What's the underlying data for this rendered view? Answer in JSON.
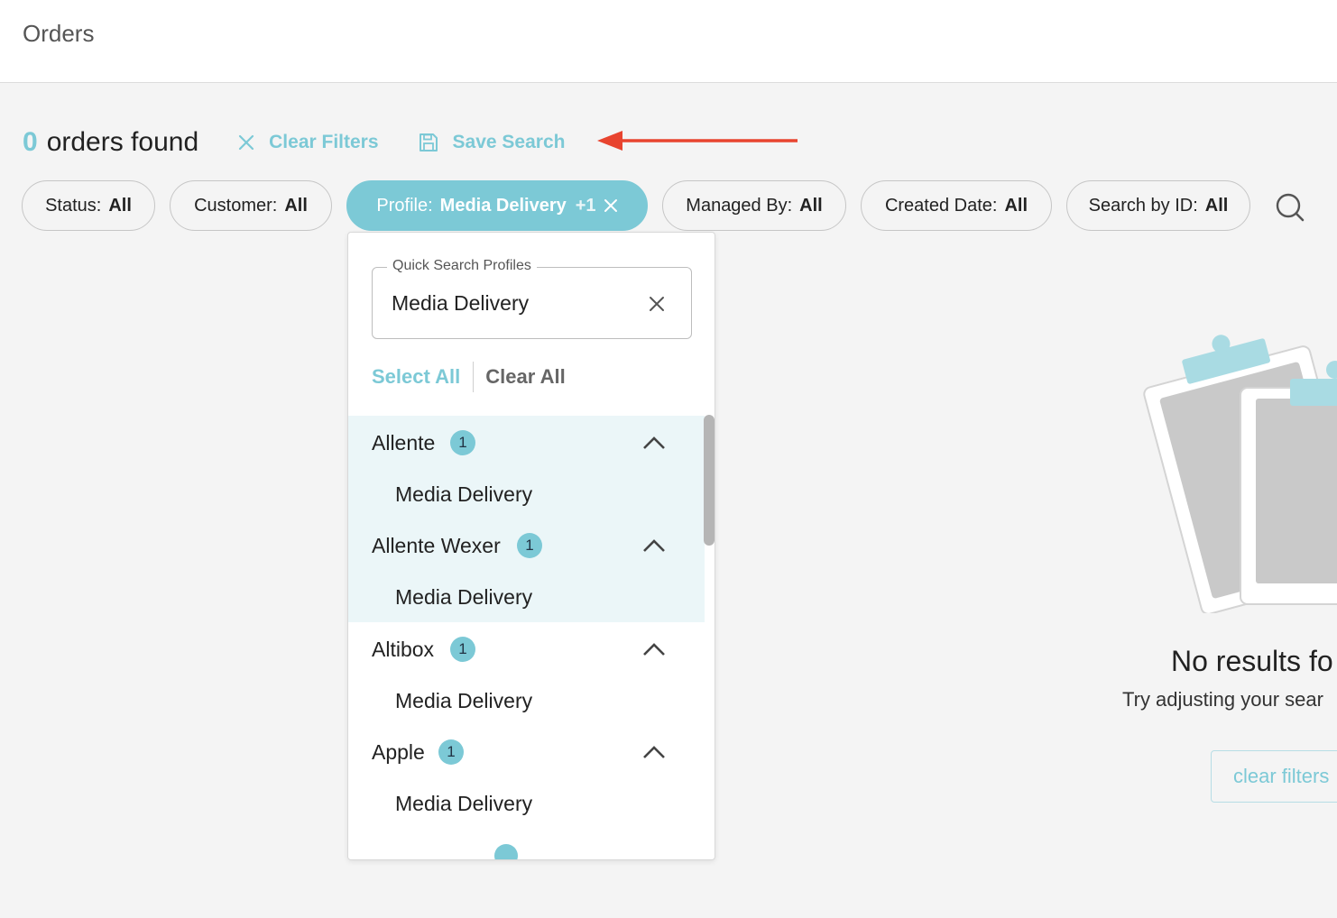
{
  "header": {
    "title": "Orders"
  },
  "results": {
    "count": "0",
    "label": "orders found",
    "clear_filters": "Clear Filters",
    "save_search": "Save Search"
  },
  "filters": [
    {
      "key": "Status:",
      "value": "All"
    },
    {
      "key": "Customer:",
      "value": "All"
    },
    {
      "key": "Profile:",
      "value": "Media Delivery",
      "extra": "+1",
      "active": true
    },
    {
      "key": "Managed By:",
      "value": "All"
    },
    {
      "key": "Created Date:",
      "value": "All"
    },
    {
      "key": "Search by ID:",
      "value": "All"
    }
  ],
  "dropdown": {
    "search_legend": "Quick Search Profiles",
    "search_value": "Media Delivery",
    "select_all": "Select All",
    "clear_all": "Clear All",
    "groups": [
      {
        "name": "Allente",
        "count": "1",
        "item": "Media Delivery",
        "selected": true
      },
      {
        "name": "Allente Wexer",
        "count": "1",
        "item": "Media Delivery",
        "selected": true
      },
      {
        "name": "Altibox",
        "count": "1",
        "item": "Media Delivery",
        "selected": false
      },
      {
        "name": "Apple",
        "count": "1",
        "item": "Media Delivery",
        "selected": false
      }
    ]
  },
  "empty_state": {
    "title": "No results fo",
    "subtitle": "Try adjusting your sear",
    "button": "clear filters"
  },
  "colors": {
    "accent": "#7cc9d6",
    "arrow": "#e8442f",
    "highlight_row": "#ebf6f8"
  },
  "icons": [
    "close-icon",
    "save-icon",
    "search-icon",
    "chevron-up-icon",
    "arrow-annotation"
  ]
}
